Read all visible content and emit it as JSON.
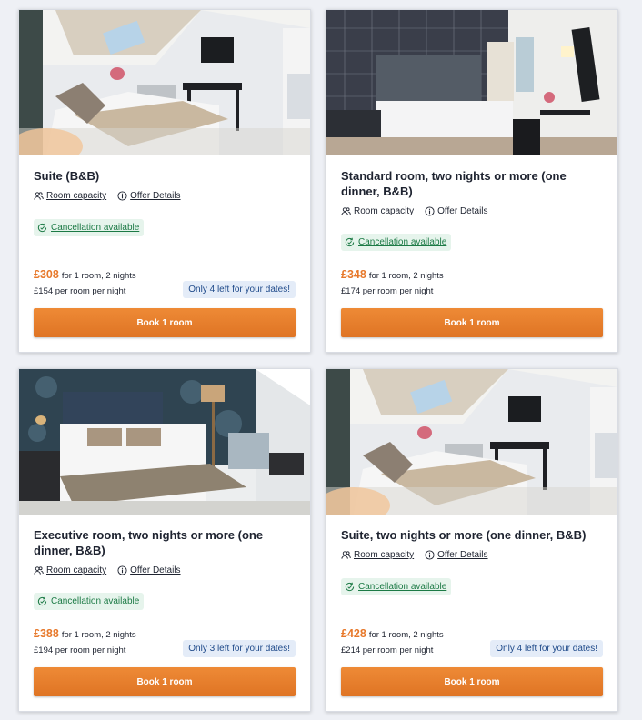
{
  "rooms": [
    {
      "title": "Suite (B&B)",
      "capacity_label": "Room capacity",
      "offer_label": "Offer Details",
      "cancellation_label": "Cancellation available",
      "price": "£308",
      "price_suffix": "for 1 room, 2 nights",
      "per_night": "£154 per room per night",
      "availability": "Only 4 left for your dates!",
      "book_label": "Book 1 room",
      "photo": "suite"
    },
    {
      "title": "Standard room, two nights or more (one dinner, B&B)",
      "capacity_label": "Room capacity",
      "offer_label": "Offer Details",
      "cancellation_label": "Cancellation available",
      "price": "£348",
      "price_suffix": "for 1 room, 2 nights",
      "per_night": "£174 per room per night",
      "availability": "",
      "book_label": "Book 1 room",
      "photo": "standard"
    },
    {
      "title": "Executive room, two nights or more (one dinner, B&B)",
      "capacity_label": "Room capacity",
      "offer_label": "Offer Details",
      "cancellation_label": "Cancellation available",
      "price": "£388",
      "price_suffix": "for 1 room, 2 nights",
      "per_night": "£194 per room per night",
      "availability": "Only 3 left for your dates!",
      "book_label": "Book 1 room",
      "photo": "executive"
    },
    {
      "title": "Suite, two nights or more (one dinner, B&B)",
      "capacity_label": "Room capacity",
      "offer_label": "Offer Details",
      "cancellation_label": "Cancellation available",
      "price": "£428",
      "price_suffix": "for 1 room, 2 nights",
      "per_night": "£214 per room per night",
      "availability": "Only 4 left for your dates!",
      "book_label": "Book 1 room",
      "photo": "suite"
    }
  ],
  "icons": {
    "capacity": "users-icon",
    "offer": "info-icon",
    "cancellation": "refresh-check-icon"
  },
  "colors": {
    "accent": "#e7782a",
    "button": "#e7802e",
    "cancellation_bg": "#e6f4ec",
    "cancellation_text": "#1c7a45",
    "availability_bg": "#e4ecf8",
    "availability_text": "#1f4a8a"
  }
}
